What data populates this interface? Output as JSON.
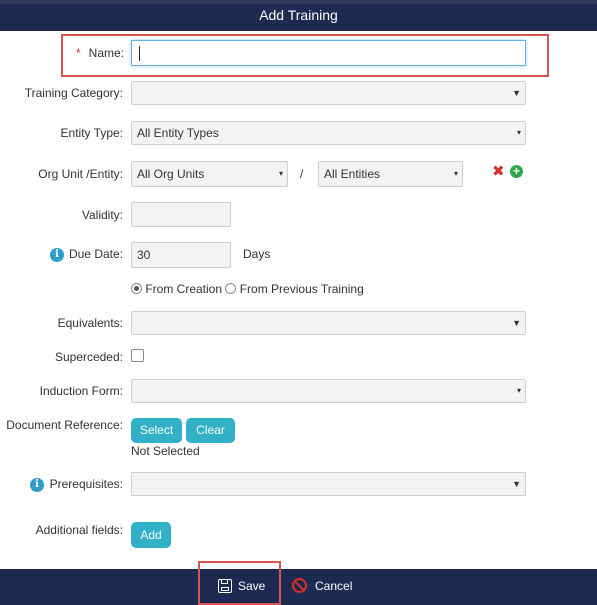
{
  "dialog": {
    "title": "Add Training"
  },
  "form": {
    "name": {
      "label": "Name:",
      "required_mark": "*",
      "value": ""
    },
    "training_category": {
      "label": "Training Category:",
      "value": ""
    },
    "entity_type": {
      "label": "Entity Type:",
      "value": "All Entity Types"
    },
    "org_unit_entity": {
      "label": "Org Unit /Entity:",
      "org_unit_value": "All Org Units",
      "separator": "/",
      "entity_value": "All Entities"
    },
    "validity": {
      "label": "Validity:",
      "value": ""
    },
    "due_date": {
      "label": "Due Date:",
      "value": "30",
      "unit": "Days",
      "options": [
        "From Creation",
        "From Previous Training"
      ],
      "selected": "From Creation"
    },
    "equivalents": {
      "label": "Equivalents:",
      "value": ""
    },
    "superceded": {
      "label": "Superceded:",
      "checked": false
    },
    "induction_form": {
      "label": "Induction Form:",
      "value": ""
    },
    "document_reference": {
      "label": "Document Reference:",
      "select_label": "Select",
      "clear_label": "Clear",
      "status": "Not Selected"
    },
    "prerequisites": {
      "label": "Prerequisites:",
      "value": ""
    },
    "additional_fields": {
      "label": "Additional fields:",
      "add_label": "Add"
    }
  },
  "footer": {
    "save_label": "Save",
    "cancel_label": "Cancel"
  },
  "colors": {
    "header_bg": "#1d2a52",
    "button_teal": "#31b0c8",
    "highlight_red": "#d9534f",
    "remove_red": "#d9302c",
    "add_green": "#2ea84a",
    "info_blue": "#2e9ccb"
  }
}
